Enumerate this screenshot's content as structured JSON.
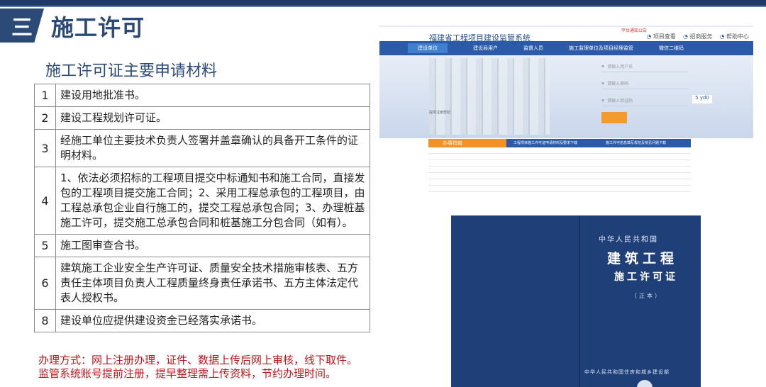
{
  "section": {
    "number": "三",
    "title": "施工许可"
  },
  "subtitle": "施工许可证主要申请材料",
  "materials": [
    {
      "num": "1",
      "text": "建设用地批准书。"
    },
    {
      "num": "2",
      "text": "建设工程规划许可证。"
    },
    {
      "num": "3",
      "text": "经施工单位主要技术负责人签署并盖章确认的具备开工条件的证明材料。"
    },
    {
      "num": "4",
      "text": "1、依法必须招标的工程项目提交中标通知书和施工合同，直接发包的工程项目提交施工合同；2、采用工程总承包的工程项目，由工程总承包企业自行施工的，提交工程总承包合同；3、办理桩基施工许可，提交施工总承包合同和桩基施工分包合同（如有）。"
    },
    {
      "num": "5",
      "text": "施工图审查合书。"
    },
    {
      "num": "6",
      "text": "建筑施工企业安全生产许可证、质量安全技术措施审核表、五方责任主体项目负责人工程质量终身责任承诺书、五方主体法定代表人授权书。"
    },
    {
      "num": "8",
      "text": "建设单位应提供建设资金已经落实承诺书。"
    }
  ],
  "method": {
    "line1": "办理方式：网上注册办理，证件、数据上传后网上审核，线下取件。",
    "line2": "监管系统账号提前注册，提早整理需上传资料，节约办理时间。"
  },
  "website": {
    "title": "福建省工程项目建设监管系统",
    "notice": "平台通知公告",
    "links": [
      "项目查看",
      "招商服务",
      "帮助中心"
    ],
    "nav": [
      "建设单位",
      "建设局用户",
      "监督人员",
      "施工监理单位及项目经理监管",
      "微信二维码"
    ],
    "login_fields": [
      "请输入用户名",
      "请输入密码",
      "请输入验证码"
    ],
    "captcha": "5 yd0",
    "desc": "提供注册帮助",
    "service_tab": "办事指南",
    "tabs": [
      "工程项目施工许可证申请材料及要求下载",
      "施工许可信息填写规范及常见问题下载"
    ]
  },
  "certificate": {
    "line1": "中华人民共和国",
    "line2": "建筑工程",
    "line3": "施工许可证",
    "line4": "（正本）",
    "issuer": "中华人民共和国住房和城乡建设部"
  },
  "colors": {
    "brand_blue": "#2c4a78",
    "alert_red": "#c0141b"
  }
}
